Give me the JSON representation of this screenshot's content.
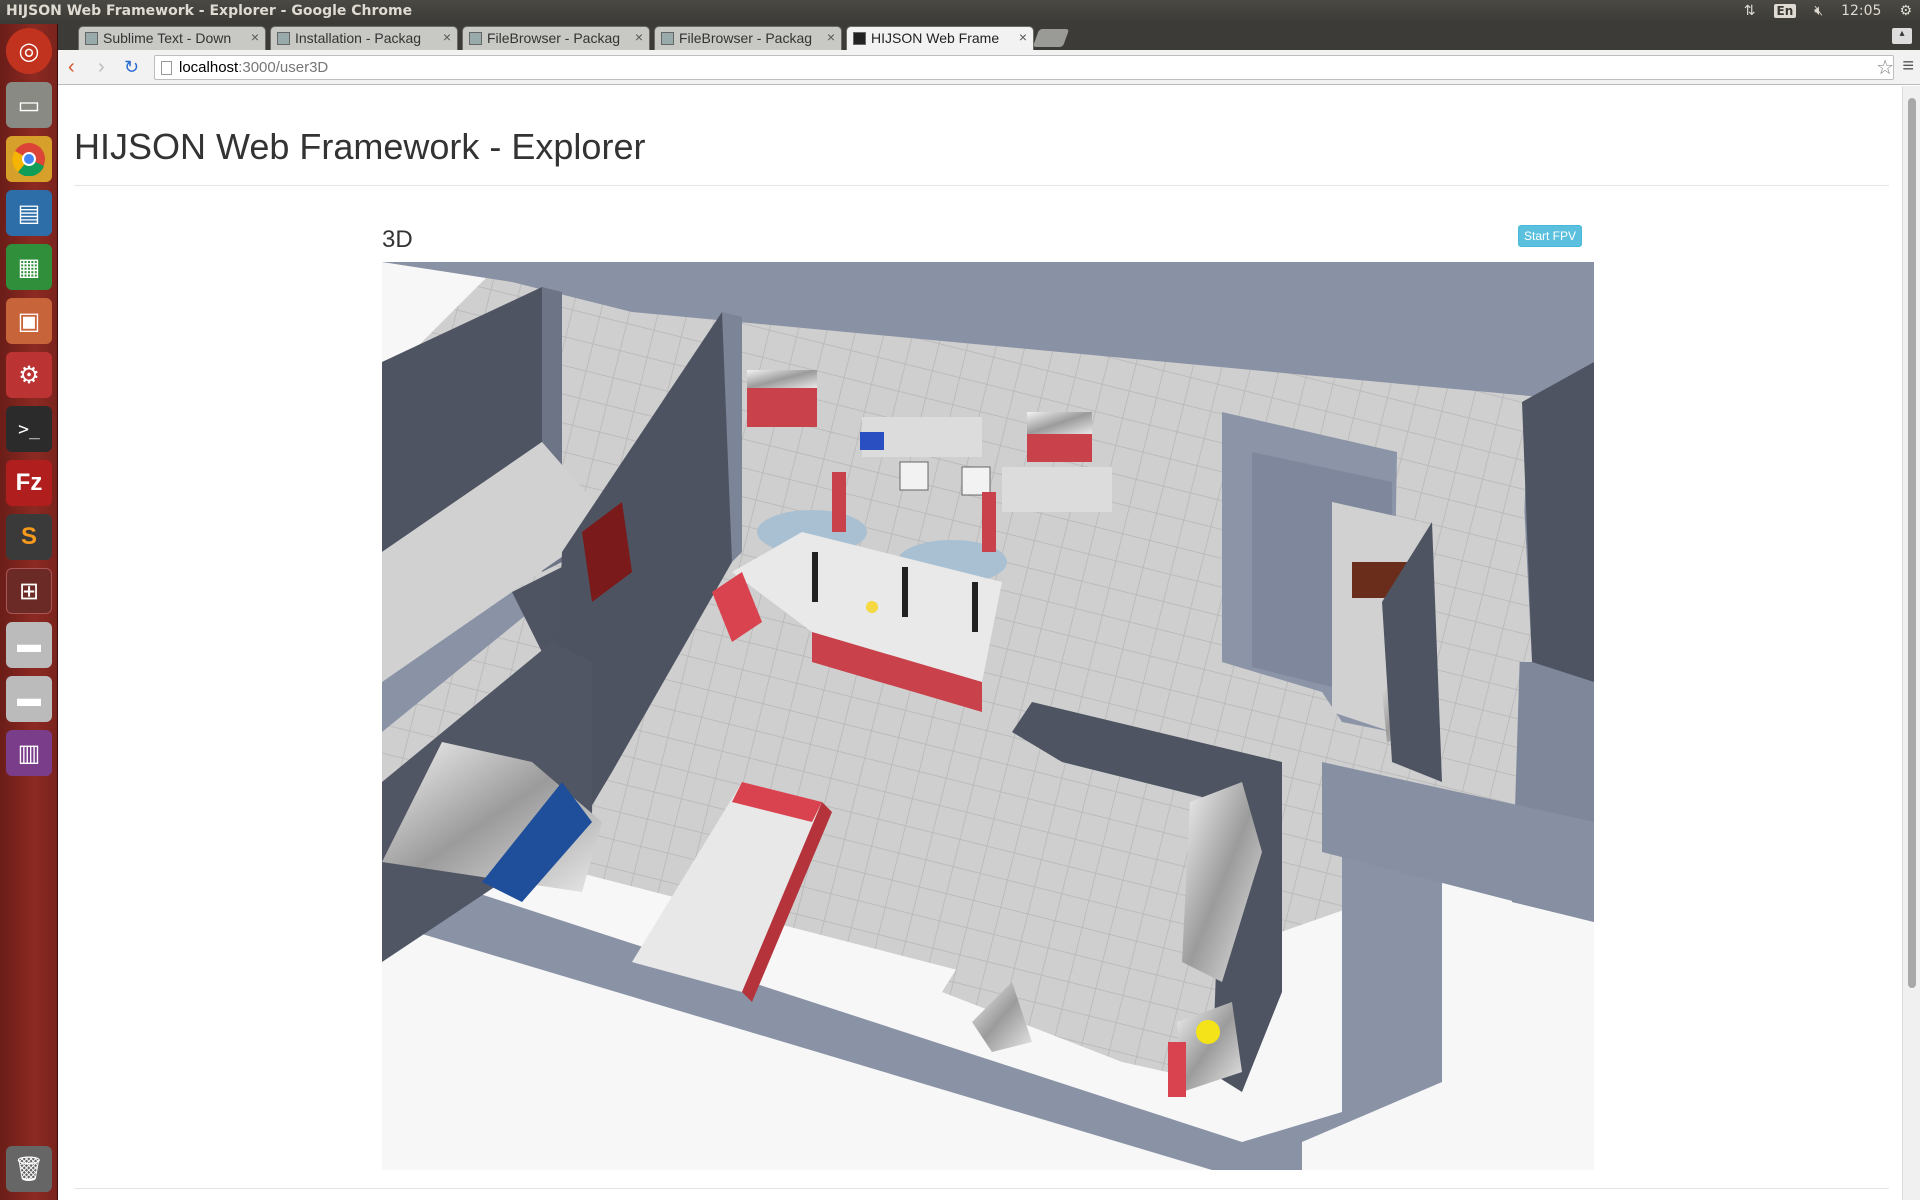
{
  "window": {
    "title": "HIJSON Web Framework - Explorer - Google Chrome"
  },
  "tray": {
    "lang": "En",
    "time": "12:05"
  },
  "tabs": [
    {
      "label": "Sublime Text - Down",
      "active": false
    },
    {
      "label": "Installation - Packag",
      "active": false
    },
    {
      "label": "FileBrowser - Packag",
      "active": false
    },
    {
      "label": "FileBrowser - Packag",
      "active": false
    },
    {
      "label": "HIJSON Web Frame",
      "active": true
    }
  ],
  "address": {
    "host": "localhost",
    "path": ":3000/user3D"
  },
  "page": {
    "heading": "HIJSON Web Framework - Explorer",
    "panel_title": "3D",
    "fpv_button": "Start FPV"
  },
  "launcher": [
    "ubuntu-home-icon",
    "files-icon",
    "chrome-icon",
    "writer-icon",
    "calc-icon",
    "impress-icon",
    "settings-icon",
    "terminal-icon",
    "filezilla-icon",
    "sublime-icon",
    "workspaces-icon",
    "drive-icon",
    "drive-icon",
    "software-icon",
    "trash-icon"
  ],
  "colors": {
    "wall": "#8a93a6",
    "wall_dark": "#4f5462",
    "floor": "#c9c9c9",
    "accent": "#d9434f",
    "button": "#5bc0de"
  }
}
